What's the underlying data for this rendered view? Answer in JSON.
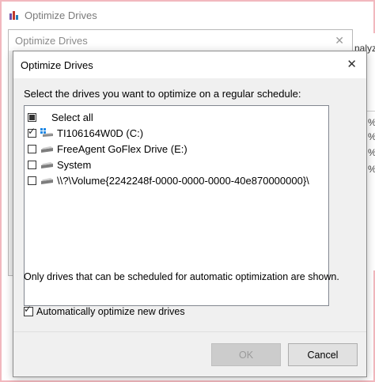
{
  "back_window": {
    "title": "Optimize Drives",
    "partial_column": "nalyze",
    "percent_marks": [
      "%",
      "%",
      "%",
      "%"
    ]
  },
  "mid_dialog": {
    "title": "Optimize Drives",
    "close_glyph": "✕"
  },
  "dialog": {
    "title": "Optimize Drives",
    "close_glyph": "✕",
    "instruction": "Select the drives you want to optimize on a regular schedule:",
    "select_all_label": "Select all",
    "drives": [
      {
        "label": "TI106164W0D (C:)",
        "checked": true,
        "icon": "windows-drive-icon"
      },
      {
        "label": "FreeAgent GoFlex Drive (E:)",
        "checked": false,
        "icon": "hard-drive-icon"
      },
      {
        "label": "System",
        "checked": false,
        "icon": "hard-drive-icon"
      },
      {
        "label": "\\\\?\\Volume{2242248f-0000-0000-0000-40e870000000}\\",
        "checked": false,
        "icon": "hard-drive-icon"
      }
    ],
    "note": "Only drives that can be scheduled for automatic optimization are shown.",
    "auto_optimize_label": "Automatically optimize new drives",
    "auto_optimize_checked": true,
    "ok_label": "OK",
    "cancel_label": "Cancel"
  },
  "colors": {
    "accent_frame": "#f2b8be",
    "dialog_bg": "#f0f0f0",
    "windows_blue": "#1e88e5"
  }
}
